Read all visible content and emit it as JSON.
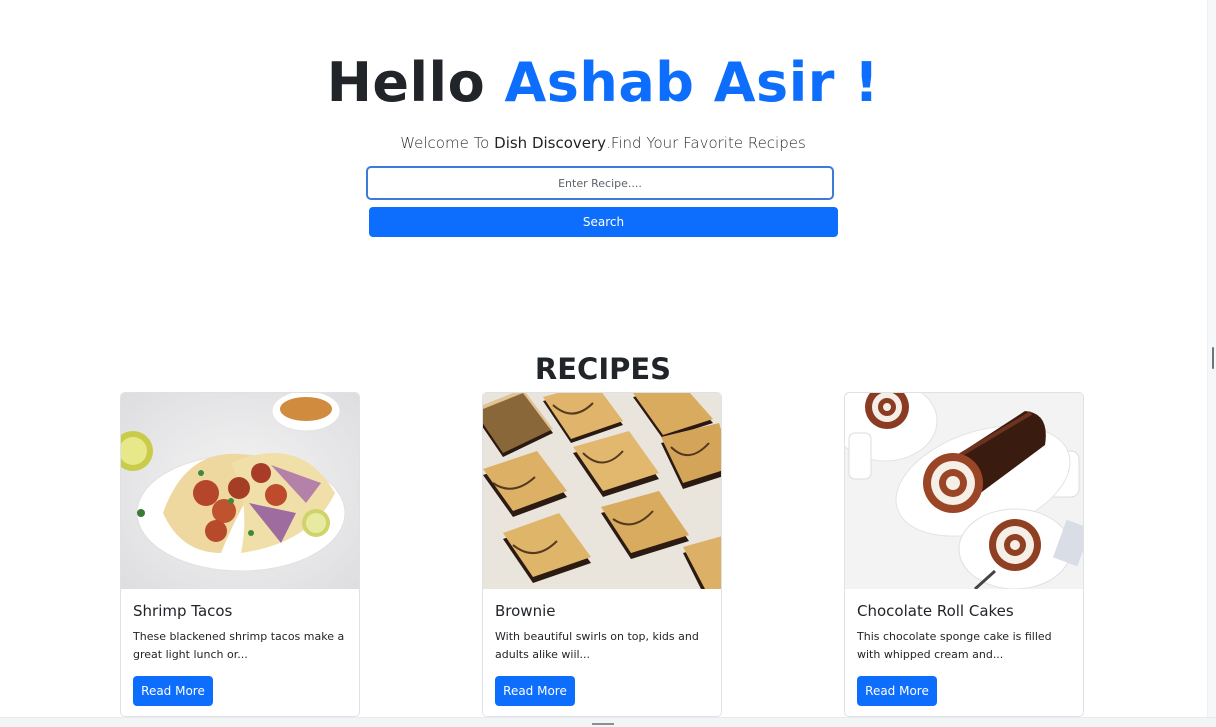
{
  "hero": {
    "greeting": "Hello ",
    "user_name": "Ashab Asir !",
    "welcome_prefix": "Welcome To ",
    "brand": "Dish Discovery",
    "welcome_suffix": ".Find Your Favorite Recipes"
  },
  "search": {
    "placeholder": "Enter Recipe....",
    "value": "",
    "button_label": "Search"
  },
  "recipes": {
    "heading": "RECIPES",
    "items": [
      {
        "title": "Shrimp Tacos",
        "description": "These blackened shrimp tacos make a great light lunch or...",
        "button_label": "Read More",
        "image_icon": "shrimp-tacos-photo"
      },
      {
        "title": "Brownie",
        "description": "With beautiful swirls on top, kids and adults alike wiil...",
        "button_label": "Read More",
        "image_icon": "brownie-photo"
      },
      {
        "title": "Chocolate Roll Cakes",
        "description": "This chocolate sponge cake is filled with whipped cream and...",
        "button_label": "Read More",
        "image_icon": "chocolate-roll-cake-photo"
      }
    ]
  },
  "colors": {
    "accent": "#0d6efd",
    "text": "#212529",
    "card_border": "#dee2e6"
  }
}
